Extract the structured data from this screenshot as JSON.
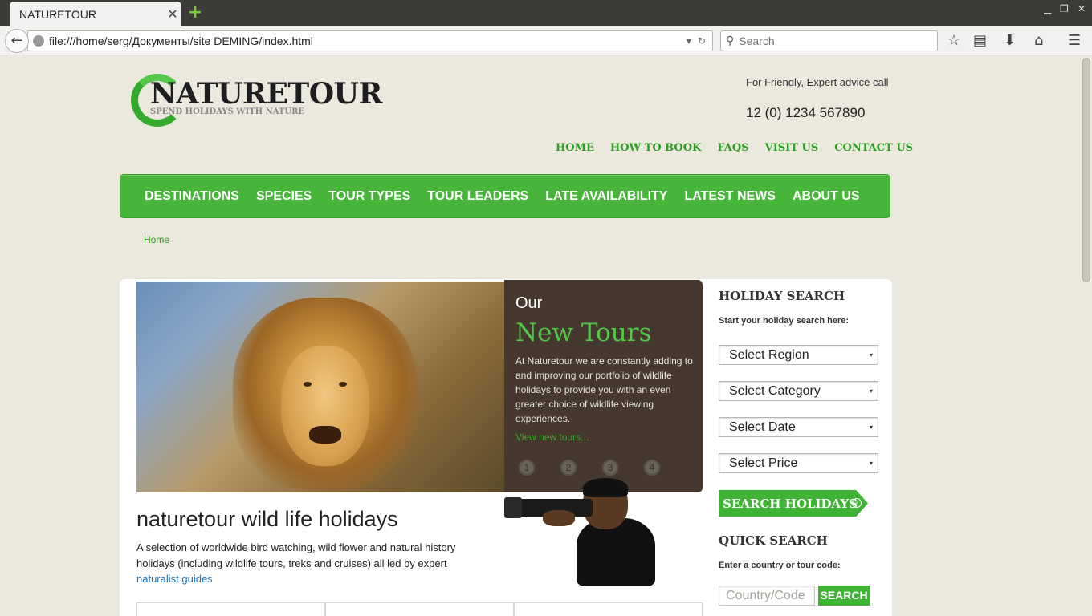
{
  "browser": {
    "tab_title": "NATURETOUR",
    "tab_close": "✕",
    "url": "file:///home/serg/Документы/site DEMING/index.html",
    "search_placeholder": "Search"
  },
  "header": {
    "logo_title": "NATURETOUR",
    "logo_tagline": "SPEND HOLIDAYS WITH NATURE",
    "advice_text": "For Friendly, Expert advice call",
    "phone": "12 (0) 1234 567890"
  },
  "top_nav": [
    "HOME",
    "HOW TO BOOK",
    "FAQS",
    "VISIT US",
    "CONTACT US"
  ],
  "main_nav": [
    "DESTINATIONS",
    "SPECIES",
    "TOUR TYPES",
    "TOUR LEADERS",
    "LATE AVAILABILITY",
    "LATEST NEWS",
    "ABOUT US"
  ],
  "breadcrumb": "Home",
  "promo": {
    "our": "Our",
    "title": "New Tours",
    "text": "At Naturetour we are constantly adding to and improving our portfolio of wildlife holidays to provide you with an even greater choice of wildlife viewing experiences.",
    "link": "View new tours...",
    "dots": [
      "1",
      "2",
      "3",
      "4"
    ]
  },
  "intro": {
    "title": "naturetour wild life holidays",
    "text": "A selection of worldwide bird watching, wild flower and natural history holidays (including wildlife tours, treks and cruises) all led by expert",
    "link": "naturalist guides"
  },
  "sidebar": {
    "holiday_title": "HOLIDAY SEARCH",
    "holiday_sub": "Start your holiday search here:",
    "selects": [
      "Select Region",
      "Select Category",
      "Select Date",
      "Select Price"
    ],
    "search_button": "SEARCH HOLIDAYS",
    "quick_title": "QUICK SEARCH",
    "quick_sub": "Enter a country or tour code:",
    "quick_placeholder": "Country/Code",
    "quick_button": "SEARCH"
  }
}
